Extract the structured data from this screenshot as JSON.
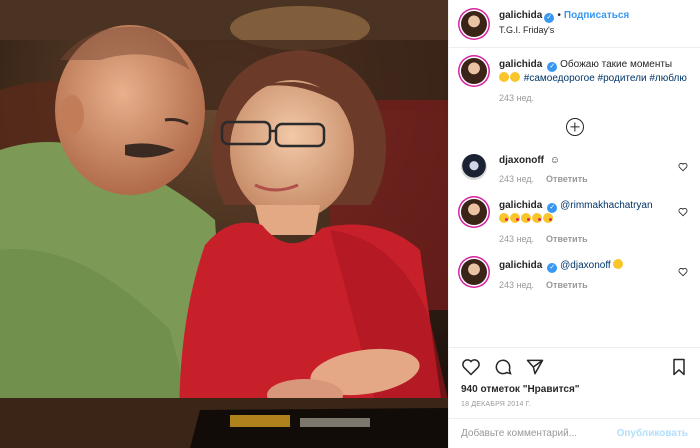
{
  "post": {
    "username": "galichida",
    "follow_label": "Подписаться",
    "dot": "•",
    "location": "T.G.I. Friday's"
  },
  "comments": [
    {
      "username": "galichida",
      "text": "Обожаю такие моменты",
      "tags": "#самоедорогое #родители #люблю",
      "age": "243 нед.",
      "is_caption": true
    },
    {
      "username": "djaxonoff",
      "text": "☺",
      "age": "243 нед.",
      "reply_label": "Ответить"
    },
    {
      "username": "galichida",
      "mention": "@rimmakhachatryan",
      "age": "243 нед.",
      "reply_label": "Ответить"
    },
    {
      "username": "galichida",
      "mention": "@djaxonoff",
      "age": "243 нед.",
      "reply_label": "Ответить"
    }
  ],
  "actions": {
    "likes": "940 отметок \"Нравится\"",
    "date": "18 ДЕКАБРЯ 2014 Г."
  },
  "add_comment": {
    "placeholder": "Добавьте комментарий...",
    "publish_label": "Опубликовать"
  },
  "icons": {
    "heart": "heart-icon",
    "comment": "comment-icon",
    "share": "share-icon",
    "bookmark": "bookmark-icon",
    "verified": "verified-badge-icon",
    "more": "plus-circle-icon"
  },
  "colors": {
    "accent": "#3897f0",
    "text": "#262626",
    "muted": "#999999",
    "tag": "#003569"
  }
}
